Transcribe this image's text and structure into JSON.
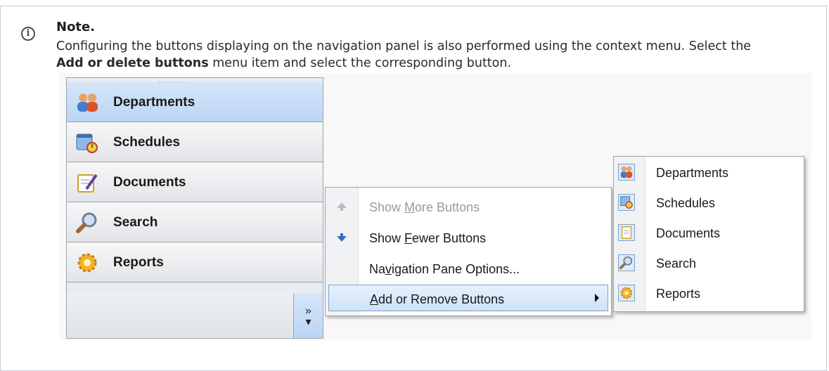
{
  "note": {
    "title": "Note.",
    "text_before": "Configuring the buttons displaying on the navigation panel is also performed using the context menu. Select the ",
    "text_bold": "Add or delete buttons",
    "text_after": " menu item and select the corresponding button."
  },
  "navpane": {
    "grip": "·········",
    "buttons": [
      {
        "label": "Departments",
        "icon": "departments-icon",
        "selected": true
      },
      {
        "label": "Schedules",
        "icon": "schedules-icon",
        "selected": false
      },
      {
        "label": "Documents",
        "icon": "documents-icon",
        "selected": false
      },
      {
        "label": "Search",
        "icon": "search-icon",
        "selected": false
      },
      {
        "label": "Reports",
        "icon": "reports-icon",
        "selected": false
      }
    ],
    "chevron": "»"
  },
  "context_menu": {
    "items": [
      {
        "pre": "Show ",
        "u": "M",
        "post": "ore Buttons",
        "disabled": true,
        "icon": "arrow-up-icon"
      },
      {
        "pre": "Show ",
        "u": "F",
        "post": "ewer Buttons",
        "disabled": false,
        "icon": "arrow-down-icon"
      },
      {
        "pre": "Na",
        "u": "v",
        "post": "igation Pane Options...",
        "disabled": false,
        "icon": ""
      },
      {
        "pre": "",
        "u": "A",
        "post": "dd or Remove Buttons",
        "disabled": false,
        "highlighted": true,
        "icon": ""
      }
    ]
  },
  "submenu": {
    "items": [
      {
        "label": "Departments",
        "icon": "departments-icon",
        "checked": true
      },
      {
        "label": "Schedules",
        "icon": "schedules-icon",
        "checked": true
      },
      {
        "label": "Documents",
        "icon": "documents-icon",
        "checked": true
      },
      {
        "label": "Search",
        "icon": "search-icon",
        "checked": true
      },
      {
        "label": "Reports",
        "icon": "reports-icon",
        "checked": true
      }
    ]
  },
  "colors": {
    "selected_button": "#c6dbf7",
    "menu_highlight": "#d9e8fa",
    "menu_highlight_border": "#7da2ce",
    "arrow_down": "#2f6fc9",
    "disabled_text": "#9a9a9a"
  }
}
